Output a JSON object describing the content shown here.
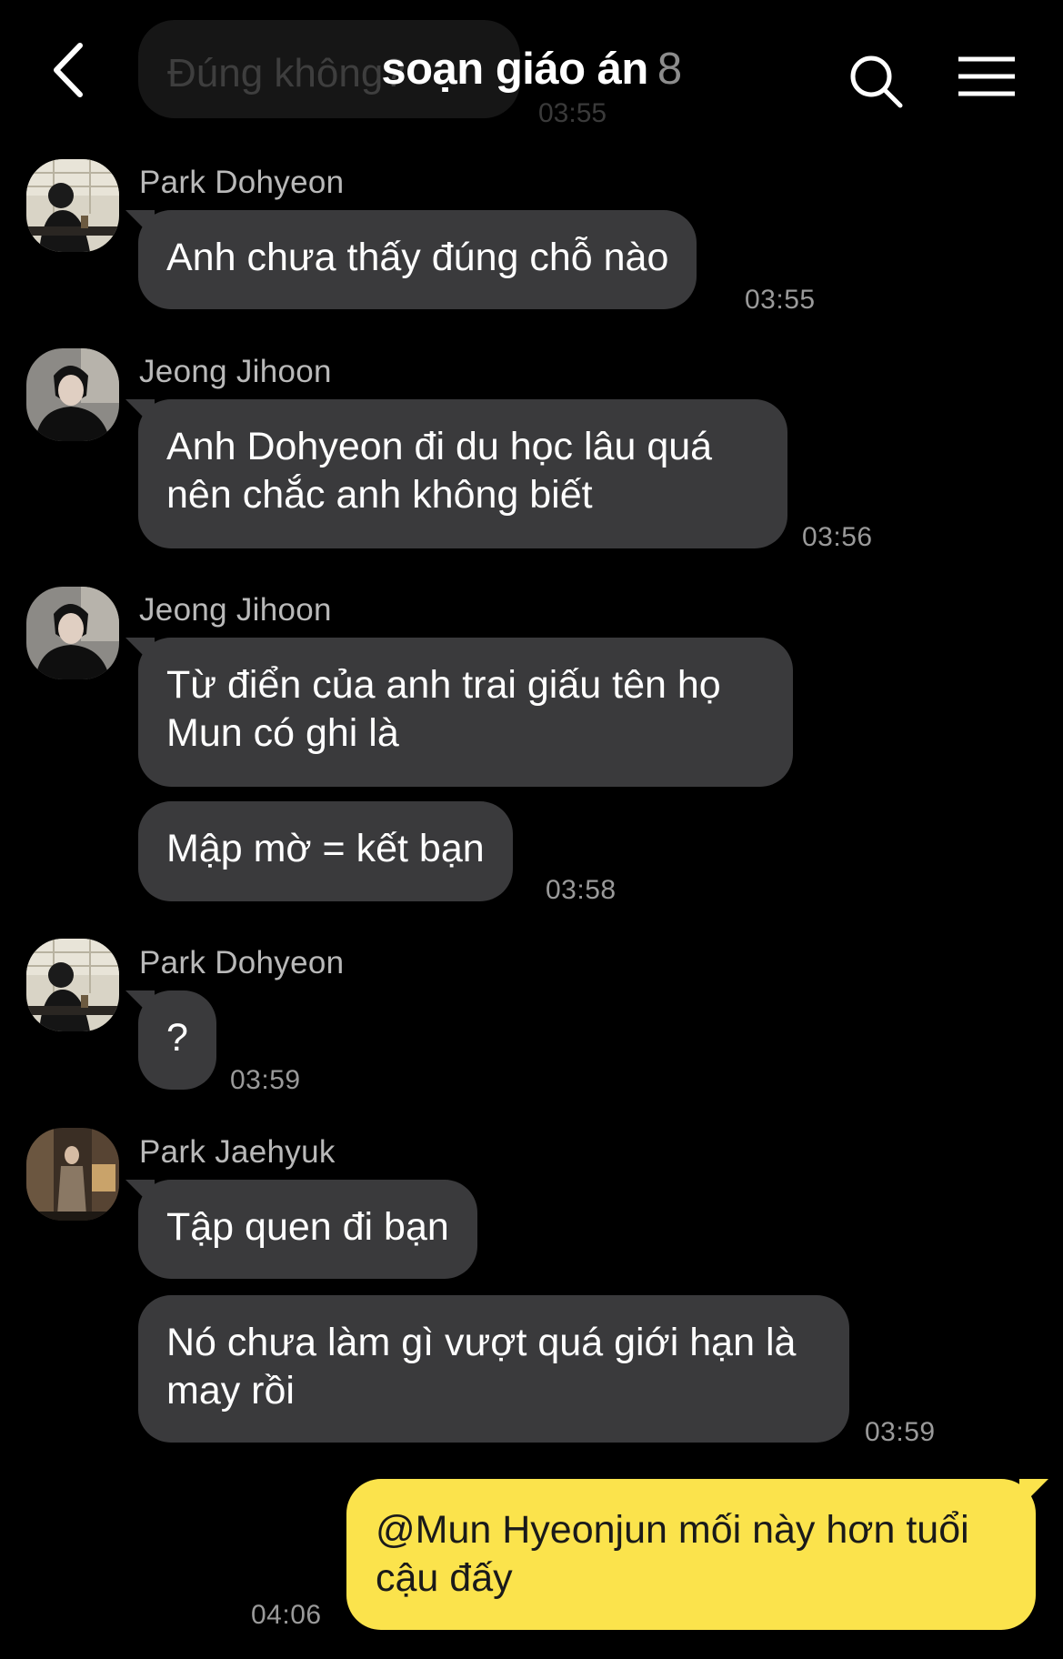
{
  "chat": {
    "title": "soạn giáo án",
    "member_count": "8",
    "previous_message": {
      "text": "Đúng không?",
      "time": "03:55"
    }
  },
  "icons": {
    "back": "chevron-left-icon",
    "search": "search-icon",
    "menu": "hamburger-menu-icon"
  },
  "messages": [
    {
      "sender": "Park Dohyeon",
      "text": "Anh chưa thấy đúng chỗ nào",
      "time": "03:55"
    },
    {
      "sender": "Jeong Jihoon",
      "text": "Anh Dohyeon đi du học lâu quá nên chắc anh không biết",
      "time": "03:56"
    },
    {
      "sender": "Jeong Jihoon",
      "text": "Từ điển của anh trai giấu tên họ Mun có ghi là",
      "time": ""
    },
    {
      "sender": "",
      "text": "Mập mờ = kết bạn",
      "time": "03:58"
    },
    {
      "sender": "Park Dohyeon",
      "text": "?",
      "time": "03:59"
    },
    {
      "sender": "Park Jaehyuk",
      "text": "Tập quen đi bạn",
      "time": ""
    },
    {
      "sender": "",
      "text": "Nó chưa làm gì vượt quá giới hạn là may rồi",
      "time": "03:59"
    }
  ],
  "my_message": {
    "text": "@Mun Hyeonjun mối này hơn tuổi cậu đấy",
    "time": "04:06"
  },
  "colors": {
    "background": "#000000",
    "incoming_bubble": "#3a3a3c",
    "outgoing_bubble": "#fbe34c",
    "timestamp": "#9a9a9a"
  }
}
